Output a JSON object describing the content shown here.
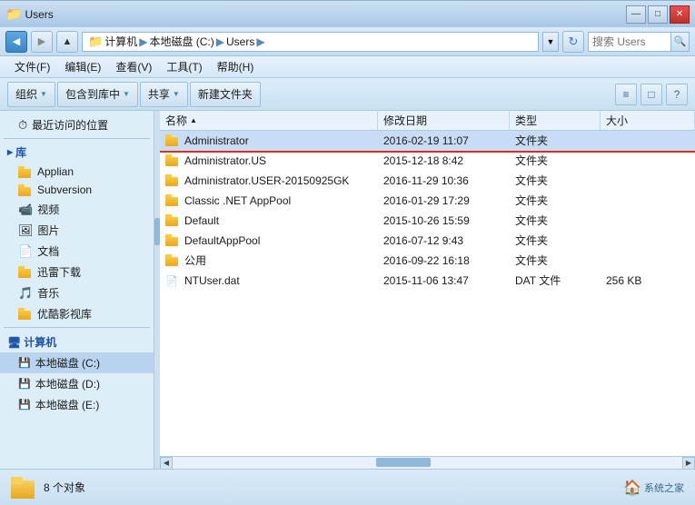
{
  "window": {
    "title": "Users",
    "controls": {
      "minimize": "—",
      "maximize": "□",
      "close": "✕"
    }
  },
  "address_bar": {
    "back_tooltip": "后退",
    "path_parts": [
      "计算机",
      "本地磁盘 (C:)",
      "Users"
    ],
    "refresh_symbol": "↻",
    "search_placeholder": "搜索 Users",
    "search_label": "搜索 Users"
  },
  "menu": {
    "items": [
      "文件(F)",
      "编辑(E)",
      "查看(V)",
      "工具(T)",
      "帮助(H)"
    ]
  },
  "toolbar": {
    "organize_label": "组织",
    "include_label": "包含到库中",
    "share_label": "共享",
    "new_folder_label": "新建文件夹",
    "view_icon": "≡",
    "preview_icon": "□",
    "help_icon": "?"
  },
  "sidebar": {
    "recent_label": "最近访问的位置",
    "library_header": "库",
    "library_items": [
      {
        "name": "Applian",
        "type": "folder"
      },
      {
        "name": "Subversion",
        "type": "folder"
      },
      {
        "name": "视频",
        "type": "library"
      },
      {
        "name": "图片",
        "type": "library"
      },
      {
        "name": "文档",
        "type": "library"
      },
      {
        "name": "迅雷下载",
        "type": "folder"
      },
      {
        "name": "音乐",
        "type": "library"
      },
      {
        "name": "优酷影视库",
        "type": "folder"
      }
    ],
    "computer_header": "计算机",
    "computer_items": [
      {
        "name": "本地磁盘 (C:)",
        "type": "drive"
      },
      {
        "name": "本地磁盘 (D:)",
        "type": "drive"
      },
      {
        "name": "本地磁盘 (E:)",
        "type": "drive"
      }
    ]
  },
  "file_list": {
    "columns": {
      "name": "名称",
      "date": "修改日期",
      "type": "类型",
      "size": "大小"
    },
    "sort_arrow": "▲",
    "files": [
      {
        "name": "Administrator",
        "date": "2016-02-19 11:07",
        "type": "文件夹",
        "size": "",
        "icon": "folder",
        "selected": true
      },
      {
        "name": "Administrator.US",
        "date": "2015-12-18 8:42",
        "type": "文件夹",
        "size": "",
        "icon": "folder",
        "selected": false
      },
      {
        "name": "Administrator.USER-20150925GK",
        "date": "2016-11-29 10:36",
        "type": "文件夹",
        "size": "",
        "icon": "folder",
        "selected": false
      },
      {
        "name": "Classic .NET AppPool",
        "date": "2016-01-29 17:29",
        "type": "文件夹",
        "size": "",
        "icon": "folder",
        "selected": false
      },
      {
        "name": "Default",
        "date": "2015-10-26 15:59",
        "type": "文件夹",
        "size": "",
        "icon": "folder",
        "selected": false
      },
      {
        "name": "DefaultAppPool",
        "date": "2016-07-12 9:43",
        "type": "文件夹",
        "size": "",
        "icon": "folder",
        "selected": false
      },
      {
        "name": "公用",
        "date": "2016-09-22 16:18",
        "type": "文件夹",
        "size": "",
        "icon": "folder",
        "selected": false
      },
      {
        "name": "NTUser.dat",
        "date": "2015-11-06 13:47",
        "type": "DAT 文件",
        "size": "256 KB",
        "icon": "dat",
        "selected": false
      }
    ]
  },
  "status_bar": {
    "count": "8 个对象",
    "logo_text": "系统之家"
  }
}
